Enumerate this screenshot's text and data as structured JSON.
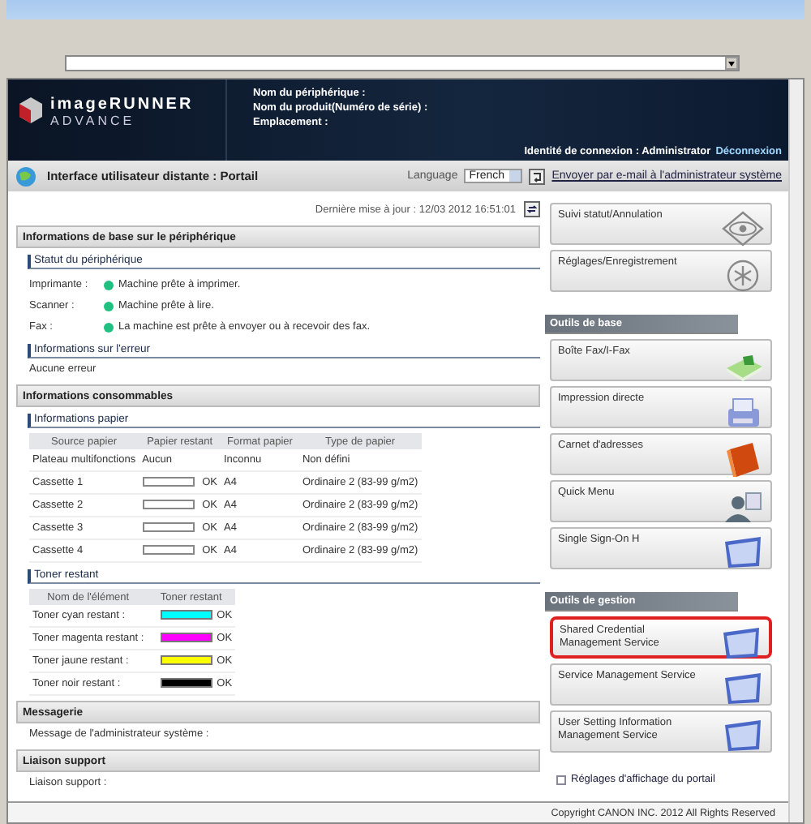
{
  "header": {
    "brand": "imageRUNNER",
    "brand_sub": "ADVANCE",
    "fields": [
      "Nom du périphérique :",
      "Nom du produit(Numéro de série) :",
      "Emplacement :"
    ],
    "login": "Identité de connexion : Administrator",
    "logout": "Déconnexion"
  },
  "nav": {
    "title": "Interface utilisateur distante : Portail",
    "language_label": "Language",
    "language": "French",
    "email_link": "Envoyer par e-mail à l'administrateur système"
  },
  "last_update": "Dernière mise à jour : 12/03 2012 16:51:01",
  "device": {
    "title": "Informations de base sur le périphérique",
    "status_title": "Statut du périphérique",
    "status": [
      {
        "label": "Imprimante :",
        "text": "Machine prête à imprimer.",
        "color": "#20c080"
      },
      {
        "label": "Scanner :",
        "text": "Machine prête à lire.",
        "color": "#20c080"
      },
      {
        "label": "Fax :",
        "text": "La machine est prête à envoyer ou à recevoir des fax.",
        "color": "#20c080"
      }
    ],
    "error_title": "Informations sur l'erreur",
    "error": "Aucune erreur"
  },
  "consumables": {
    "title": "Informations consommables",
    "paper_title": "Informations papier",
    "paper_columns": [
      "Source papier",
      "Papier restant",
      "Format papier",
      "Type de papier"
    ],
    "paper_rows": [
      {
        "source": "Plateau multifonctions",
        "gauge": false,
        "remaining": "Aucun",
        "size": "Inconnu",
        "type": "Non défini"
      },
      {
        "source": "Cassette 1",
        "gauge": true,
        "remaining": "OK",
        "size": "A4",
        "type": "Ordinaire 2 (83-99 g/m2)"
      },
      {
        "source": "Cassette 2",
        "gauge": true,
        "remaining": "OK",
        "size": "A4",
        "type": "Ordinaire 2 (83-99 g/m2)"
      },
      {
        "source": "Cassette 3",
        "gauge": true,
        "remaining": "OK",
        "size": "A4",
        "type": "Ordinaire 2 (83-99 g/m2)"
      },
      {
        "source": "Cassette 4",
        "gauge": true,
        "remaining": "OK",
        "size": "A4",
        "type": "Ordinaire 2 (83-99 g/m2)"
      }
    ],
    "toner_title": "Toner restant",
    "toner_columns": [
      "Nom de l'élément",
      "Toner restant"
    ],
    "toner": [
      {
        "name": "Toner cyan restant :",
        "color": "#00ffff",
        "status": "OK"
      },
      {
        "name": "Toner magenta restant :",
        "color": "#ff00ff",
        "status": "OK"
      },
      {
        "name": "Toner jaune restant :",
        "color": "#ffff00",
        "status": "OK"
      },
      {
        "name": "Toner noir restant :",
        "color": "#000000",
        "status": "OK"
      }
    ]
  },
  "messaging": {
    "title": "Messagerie",
    "label": "Message de l'administrateur système :"
  },
  "support": {
    "title": "Liaison support",
    "label": "Liaison support :"
  },
  "top_buttons": [
    {
      "label": "Suivi statut/Annulation",
      "kind": "eye",
      "selected": false
    },
    {
      "label": "Réglages/Enregistrement",
      "kind": "gear",
      "selected": false
    }
  ],
  "tool_groups": [
    {
      "title": "Outils de base",
      "buttons": [
        {
          "label": "Boîte Fax/I-Fax",
          "kind": "fax",
          "selected": false
        },
        {
          "label": "Impression directe",
          "kind": "printer",
          "selected": false
        },
        {
          "label": "Carnet d'adresses",
          "kind": "book",
          "selected": false
        },
        {
          "label": "Quick Menu",
          "kind": "person",
          "selected": false
        },
        {
          "label": "Single Sign-On H",
          "kind": "monitor",
          "selected": false
        }
      ]
    },
    {
      "title": "Outils de gestion",
      "buttons": [
        {
          "label": "Shared Credential Management Service",
          "kind": "monitor",
          "selected": true
        },
        {
          "label": "Service Management Service",
          "kind": "monitor",
          "selected": false
        },
        {
          "label": "User Setting Information Management Service",
          "kind": "monitor",
          "selected": false
        }
      ]
    }
  ],
  "portal_link": "Réglages d'affichage du portail",
  "copyright": "Copyright CANON INC. 2012 All Rights Reserved"
}
